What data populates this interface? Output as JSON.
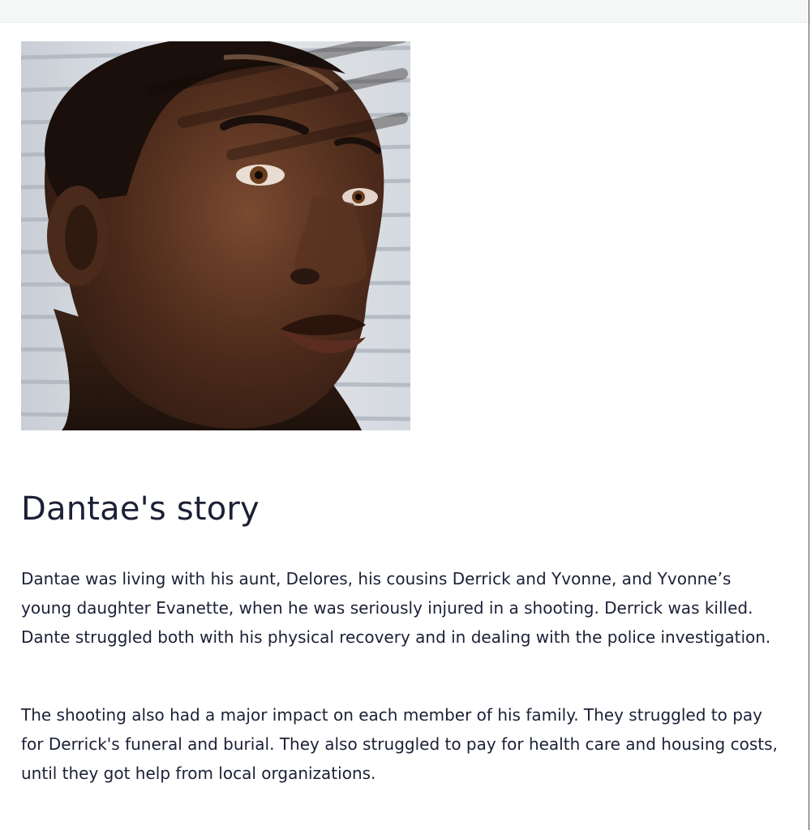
{
  "story": {
    "image_alt": "Portrait of a young man looking through window blinds",
    "title": "Dantae's story",
    "paragraphs": [
      "Dantae was living with his aunt, Delores, his cousins Derrick and Yvonne, and Yvonne’s young daughter Evanette, when he was seriously injured in a shooting. Derrick was killed. Dante struggled both with his physical recovery and in dealing with the police investigation.",
      "The shooting also had a major impact on each member of his family. They struggled to pay for Derrick's funeral and burial. They also struggled to pay for health care and housing costs, until they got help from local organizations."
    ]
  }
}
